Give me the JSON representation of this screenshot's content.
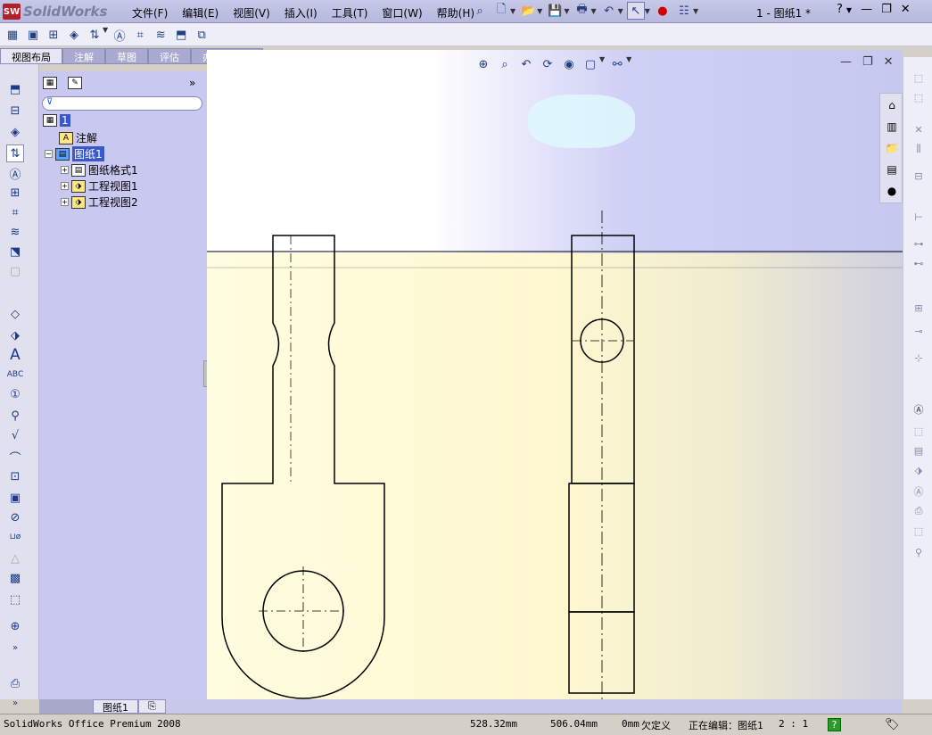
{
  "app": {
    "logo_text": "SolidWorks",
    "doc_title": "1 - 图纸1 *"
  },
  "menu": [
    "文件(F)",
    "编辑(E)",
    "视图(V)",
    "插入(I)",
    "工具(T)",
    "窗口(W)",
    "帮助(H)"
  ],
  "command_tabs": [
    "视图布局",
    "注解",
    "草图",
    "评估",
    "办公室产品"
  ],
  "feature_tree": {
    "root": "1",
    "items": [
      "注解",
      "图纸1",
      "图纸格式1",
      "工程视图1",
      "工程视图2"
    ]
  },
  "sheet_tab": "图纸1",
  "status": {
    "product": "SolidWorks Office Premium 2008",
    "x": "528.32mm",
    "y": "506.04mm",
    "z": "0mm",
    "def_state": "欠定义",
    "editing": "正在编辑：图纸1",
    "scale": "2 : 1",
    "help": "?"
  },
  "icons": {
    "window_help": "?",
    "minimize": "—",
    "restore": "❐",
    "close": "✕"
  }
}
